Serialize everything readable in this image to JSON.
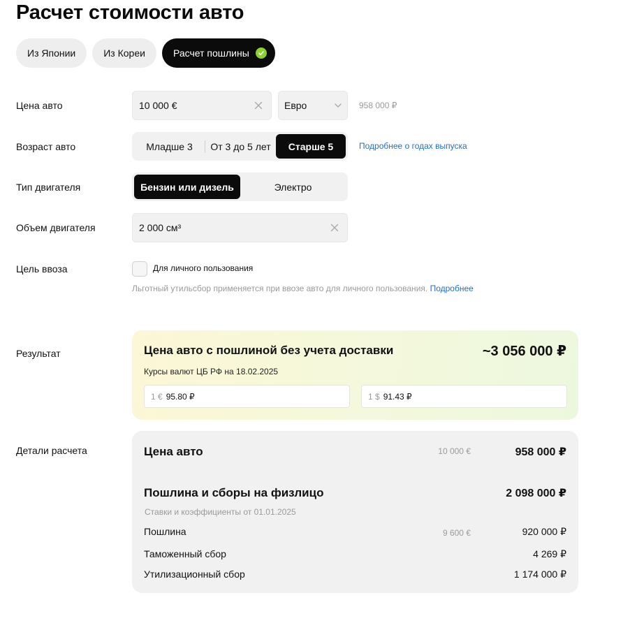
{
  "page": {
    "title": "Расчет стоимости авто"
  },
  "tabs": [
    {
      "label": "Из Японии",
      "active": false
    },
    {
      "label": "Из Кореи",
      "active": false
    },
    {
      "label": "Расчет пошлины",
      "active": true
    }
  ],
  "form": {
    "price": {
      "label": "Цена авто",
      "value": "10 000 €",
      "currency": "Евро",
      "converted": "958 000 ₽"
    },
    "age": {
      "label": "Возраст авто",
      "options": [
        "Младше 3",
        "От 3 до 5 лет",
        "Старше 5"
      ],
      "selected": "Старше 5",
      "link": "Подробнее о годах выпуска"
    },
    "engine_type": {
      "label": "Тип двигателя",
      "options": [
        "Бензин или дизель",
        "Электро"
      ],
      "selected": "Бензин или дизель"
    },
    "engine_volume": {
      "label": "Объем двигателя",
      "value": "2 000 см³"
    },
    "purpose": {
      "label": "Цель ввоза",
      "checkbox_label": "Для личного пользования",
      "checked": false,
      "note": "Льготный утильсбор применяется при ввозе авто для личного пользования.",
      "note_link": "Подробнее"
    }
  },
  "result": {
    "label": "Результат",
    "title": "Цена авто с пошлиной без учета доставки",
    "total": "~3 056 000 ₽",
    "rates_caption": "Курсы валют ЦБ РФ на 18.02.2025",
    "rates": [
      {
        "unit": "1 €",
        "value": "95.80 ₽"
      },
      {
        "unit": "1 $",
        "value": "91.43 ₽"
      }
    ]
  },
  "details": {
    "label": "Детали расчета",
    "car_price": {
      "title": "Цена авто",
      "foreign": "10 000 €",
      "value": "958 000 ₽"
    },
    "fees": {
      "title": "Пошлина и сборы на физлицо",
      "value": "2 098 000 ₽",
      "caption": "Ставки и коэффициенты от 01.01.2025",
      "rows": [
        {
          "label": "Пошлина",
          "foreign": "9 600 €",
          "value": "920 000 ₽"
        },
        {
          "label": "Таможенный сбор",
          "foreign": "",
          "value": "4 269 ₽"
        },
        {
          "label": "Утилизационный сбор",
          "foreign": "",
          "value": "1 174 000 ₽"
        }
      ]
    }
  },
  "colors": {
    "accent_black": "#0b0b0b",
    "check_green": "#8bd22f",
    "link_blue": "#1f6fcc",
    "field_bg": "#f1f1f1",
    "result_gradient_start": "#fcf7d6",
    "result_gradient_end": "#ecf8de"
  },
  "icons": {
    "tab_check": "check-circle-icon",
    "clear": "close-icon",
    "select": "chevron-down-icon"
  }
}
